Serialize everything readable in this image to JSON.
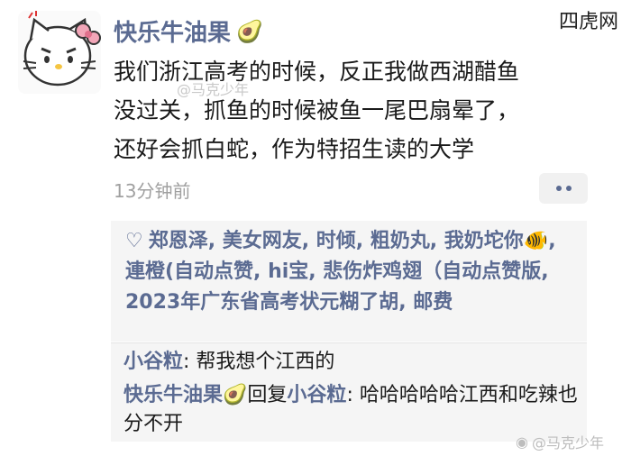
{
  "site_watermark": "四虎网",
  "post": {
    "author": "快乐牛油果",
    "author_emoji": "🥑",
    "lines": [
      "我们浙江高考的时候，反正我做西湖醋鱼",
      "没过关，抓鱼的时候被鱼一尾巴扇晕了，",
      "还好会抓白蛇，作为特招生读的大学"
    ],
    "inline_watermark": "@马克少年",
    "time": "13分钟前"
  },
  "likes": {
    "icon": "heart-outline-icon",
    "text": "郑恩泽, 美女网友, 时倾, 粗奶丸, 我奶坨你🐠, 連橙(自动点赞, hi宝, 悲伤炸鸡翅（自动点赞版, 2023年广东省高考状元糊了胡, 邮费"
  },
  "comments": [
    {
      "name": "小谷粒",
      "separator": ": ",
      "text": "帮我想个江西的"
    },
    {
      "name": "快乐牛油果🥑",
      "reply_word": "回复",
      "reply_to": "小谷粒",
      "separator": ": ",
      "text": "哈哈哈哈哈江西和吃辣也分不开"
    }
  ],
  "watermark_bottom": "@马克少年",
  "colors": {
    "name_blue": "#5b6b92",
    "bg_gray": "#f5f5f5",
    "time_gray": "#a0a0a0"
  }
}
